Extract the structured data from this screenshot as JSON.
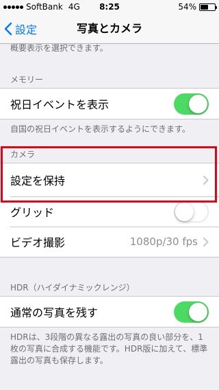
{
  "status_bar": {
    "carrier": "SoftBank",
    "network": "4G",
    "time": "8:25",
    "battery_percent": "54%",
    "battery_level": 0.54
  },
  "nav": {
    "back_label": "設定",
    "title": "写真とカメラ"
  },
  "top_footer": "概要表示を選択できます。",
  "memory_section": {
    "header": "メモリー",
    "rows": [
      {
        "label": "祝日イベントを表示",
        "toggle": "on"
      }
    ],
    "footer": "自国の祝日イベントを表示するようにできます。"
  },
  "camera_section": {
    "header": "カメラ",
    "rows": [
      {
        "label": "設定を保持",
        "chevron": true
      },
      {
        "label": "グリッド",
        "toggle": "off"
      },
      {
        "label": "ビデオ撮影",
        "value": "1080p/30 fps",
        "chevron": true
      }
    ]
  },
  "hdr_section": {
    "header": "HDR（ハイダイナミックレンジ）",
    "rows": [
      {
        "label": "通常の写真を残す",
        "toggle": "on"
      }
    ],
    "footer": "HDRは、3段階の異なる露出の写真の良い部分を、1枚の写真に合成する機能です。HDR版に加えて、標準露出の写真も保存します。"
  },
  "colors": {
    "accent": "#007aff",
    "toggle_on": "#4cd964",
    "highlight": "#e60012",
    "background": "#efeff4"
  }
}
